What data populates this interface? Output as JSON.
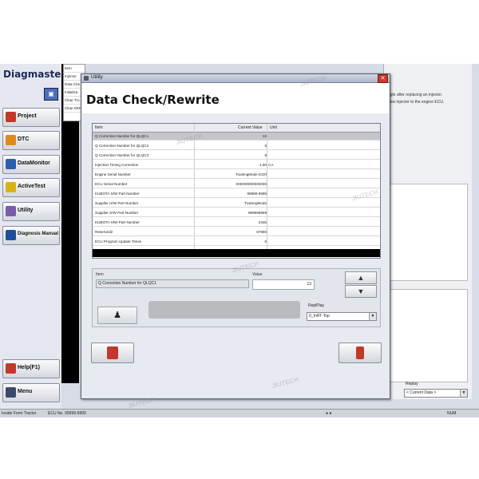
{
  "app": {
    "brand": "Diagmaster",
    "nav": [
      {
        "label": "Project",
        "icon": "project-icon",
        "color": "#c0392b"
      },
      {
        "label": "DTC",
        "icon": "dtc-icon",
        "color": "#e08a1e"
      },
      {
        "label": "DataMonitor",
        "icon": "datamonitor-icon",
        "color": "#2e5fae"
      },
      {
        "label": "ActiveTest",
        "icon": "activetest-icon",
        "color": "#d9b21a"
      },
      {
        "label": "Utility",
        "icon": "utility-icon",
        "color": "#7a5cad"
      },
      {
        "label": "Diagnosis Manual",
        "icon": "manual-icon",
        "color": "#1f4e9c"
      }
    ],
    "help_label": "Help(F1)",
    "menu_label": "Menu",
    "file_list": [
      "Item",
      "Injector",
      "Data Che",
      "Initializa",
      "Clear Tro",
      "Clear EEP"
    ],
    "right_texts": [
      "ngle after replacing an injector.",
      "new injector to the engine ECU."
    ],
    "replay_label": "Replay",
    "replay_value": "< Current Data >",
    "status": {
      "left": "Inside Form Tractor",
      "ecu": "ECU No. 99999-9999",
      "right": "NUM"
    }
  },
  "dialog": {
    "title": "Utility",
    "heading": "Data Check/Rewrite",
    "table": {
      "columns": [
        "Item",
        "Current Value",
        "Unit"
      ],
      "rows": [
        {
          "item": "Q Correction Number for QLQC1",
          "value": "13",
          "unit": ""
        },
        {
          "item": "Q Correction Number for QLQC2",
          "value": "6",
          "unit": ""
        },
        {
          "item": "Q Correction Number for QLQC3",
          "value": "8",
          "unit": ""
        },
        {
          "item": "Injection Timing Correction",
          "value": "4.50",
          "unit": "CA"
        },
        {
          "item": "Engine Serial Number",
          "value": "TrainingMode E3Xf",
          "unit": ""
        },
        {
          "item": "ECU Serial Number",
          "value": "000000000000000",
          "unit": ""
        },
        {
          "item": "KUBOTA S/W Part Number",
          "value": "99999-9999",
          "unit": ""
        },
        {
          "item": "Supplier H/W Part Number",
          "value": "TrainingMode",
          "unit": ""
        },
        {
          "item": "Supplier S/W Part Number",
          "value": "999999999",
          "unit": ""
        },
        {
          "item": "KUBOTA H/W Part Number",
          "value": "2345",
          "unit": ""
        },
        {
          "item": "Reserved2",
          "value": "67890",
          "unit": ""
        },
        {
          "item": "ECU Program Update Times",
          "value": "0",
          "unit": ""
        }
      ]
    },
    "edit": {
      "item_label": "Item",
      "item_value": "Q Correction Number for QLQC1",
      "value_label": "Value",
      "value_current": "13",
      "up": "▲",
      "down": "▼",
      "replay_label": "ReplPlay",
      "replay_value": "0_InRT-Top"
    }
  },
  "watermark": "JIUTECH"
}
